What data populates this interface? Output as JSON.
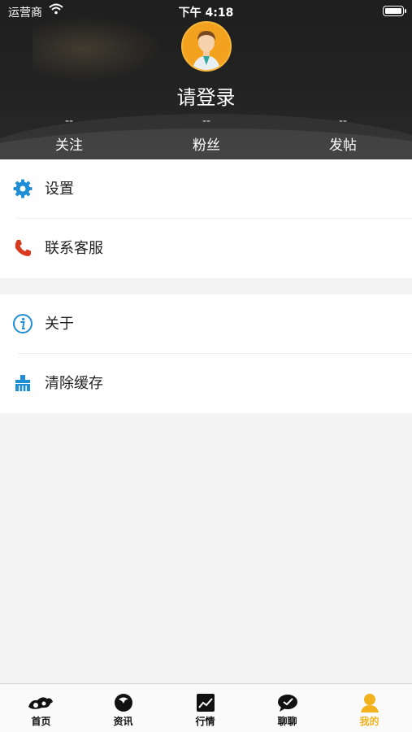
{
  "status_bar": {
    "carrier": "运营商",
    "time": "下午 4:18"
  },
  "profile": {
    "login_text": "请登录",
    "stats": [
      {
        "value": "--",
        "label": "关注"
      },
      {
        "value": "--",
        "label": "粉丝"
      },
      {
        "value": "--",
        "label": "发帖"
      }
    ]
  },
  "menu": {
    "group1": [
      {
        "label": "设置",
        "icon": "gear-icon",
        "icon_color": "#1e8fd6"
      },
      {
        "label": "联系客服",
        "icon": "phone-icon",
        "icon_color": "#d83a1f"
      }
    ],
    "group2": [
      {
        "label": "关于",
        "icon": "info-icon",
        "icon_color": "#1e8fd6"
      },
      {
        "label": "清除缓存",
        "icon": "broom-icon",
        "icon_color": "#1e8fd6"
      }
    ]
  },
  "tabbar": {
    "tabs": [
      {
        "label": "首页",
        "icon": "home-icon"
      },
      {
        "label": "资讯",
        "icon": "news-icon"
      },
      {
        "label": "行情",
        "icon": "chart-icon"
      },
      {
        "label": "聊聊",
        "icon": "chat-icon"
      },
      {
        "label": "我的",
        "icon": "profile-icon",
        "active": true
      }
    ],
    "active_color": "#f2b21e"
  },
  "colors": {
    "header_bg": "#222222",
    "accent": "#1e8fd6",
    "page_bg": "#f4f4f4"
  }
}
